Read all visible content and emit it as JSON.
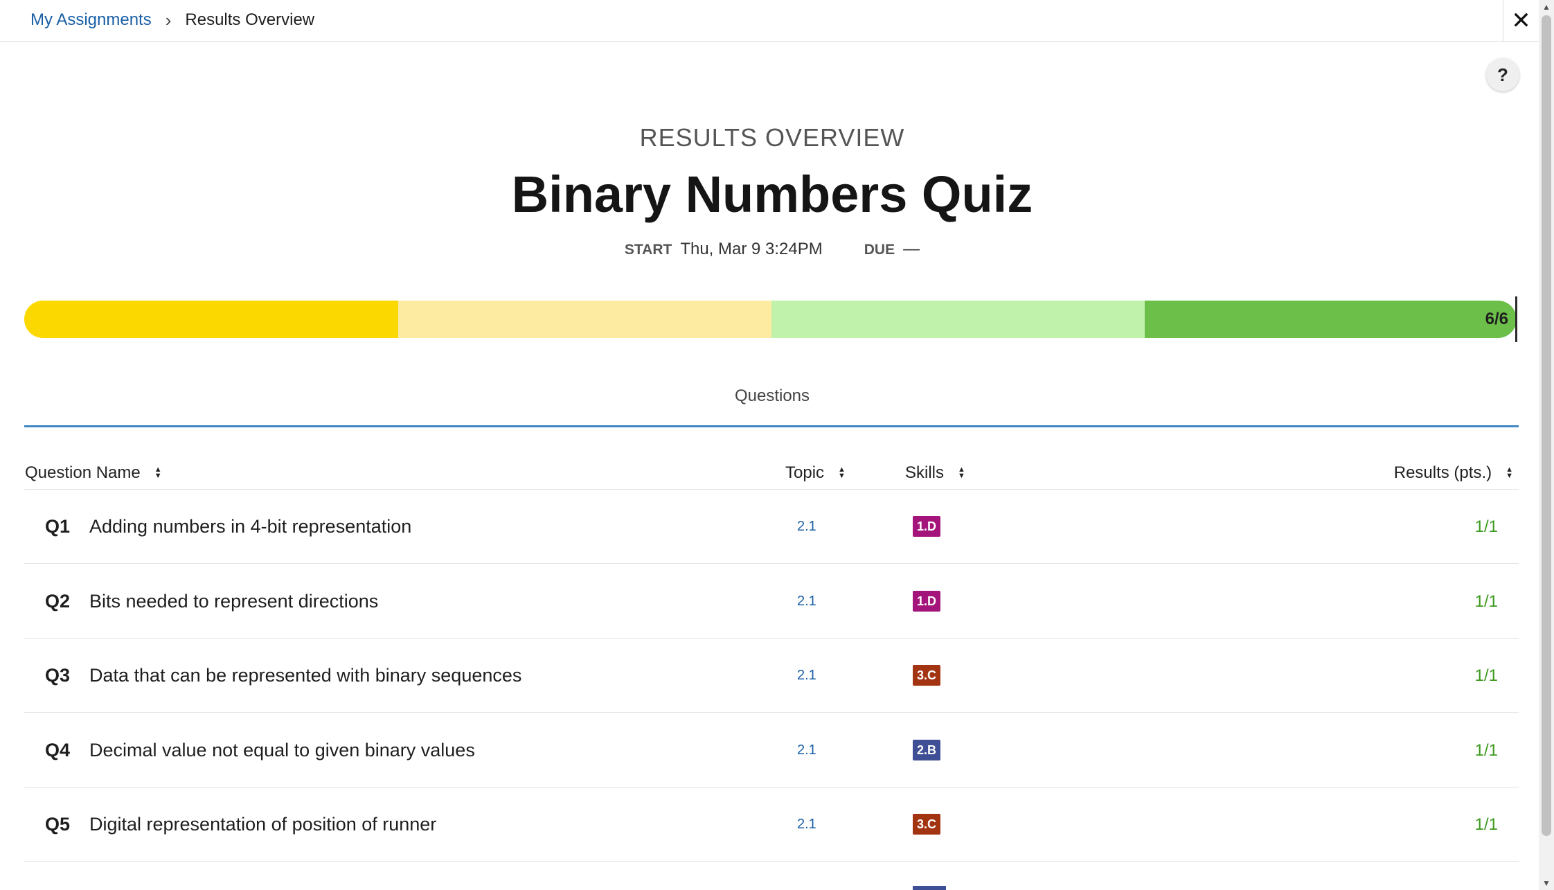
{
  "breadcrumb": {
    "link": "My Assignments",
    "separator": "›",
    "current": "Results Overview"
  },
  "close_glyph": "✕",
  "help_glyph": "?",
  "header": {
    "kicker": "RESULTS OVERVIEW",
    "title": "Binary Numbers Quiz",
    "start_label": "START",
    "start_value": "Thu, Mar 9 3:24PM",
    "due_label": "DUE",
    "due_value": "—"
  },
  "progress": {
    "score": "6/6",
    "segment_colors": [
      "#fbd900",
      "#feeba2",
      "#c0f2ac",
      "#6cc04a"
    ]
  },
  "tab": "Questions",
  "table": {
    "headers": {
      "name": "Question Name",
      "topic": "Topic",
      "skills": "Skills",
      "results": "Results (pts.)"
    },
    "rows": [
      {
        "num": "Q1",
        "name": "Adding numbers in 4-bit representation",
        "topic": "2.1",
        "skill": "1.D",
        "skill_color": "#a3157a",
        "result": "1/1"
      },
      {
        "num": "Q2",
        "name": "Bits needed to represent directions",
        "topic": "2.1",
        "skill": "1.D",
        "skill_color": "#a3157a",
        "result": "1/1"
      },
      {
        "num": "Q3",
        "name": "Data that can be represented with binary sequences",
        "topic": "2.1",
        "skill": "3.C",
        "skill_color": "#a23412",
        "result": "1/1"
      },
      {
        "num": "Q4",
        "name": "Decimal value not equal to given binary values",
        "topic": "2.1",
        "skill": "2.B",
        "skill_color": "#3f4f96",
        "result": "1/1"
      },
      {
        "num": "Q5",
        "name": "Digital representation of position of runner",
        "topic": "2.1",
        "skill": "3.C",
        "skill_color": "#a23412",
        "result": "1/1"
      }
    ]
  },
  "colors": {
    "link": "#1a5fa6",
    "result": "#3d9a1e",
    "tab_underline": "#3d87c4"
  }
}
